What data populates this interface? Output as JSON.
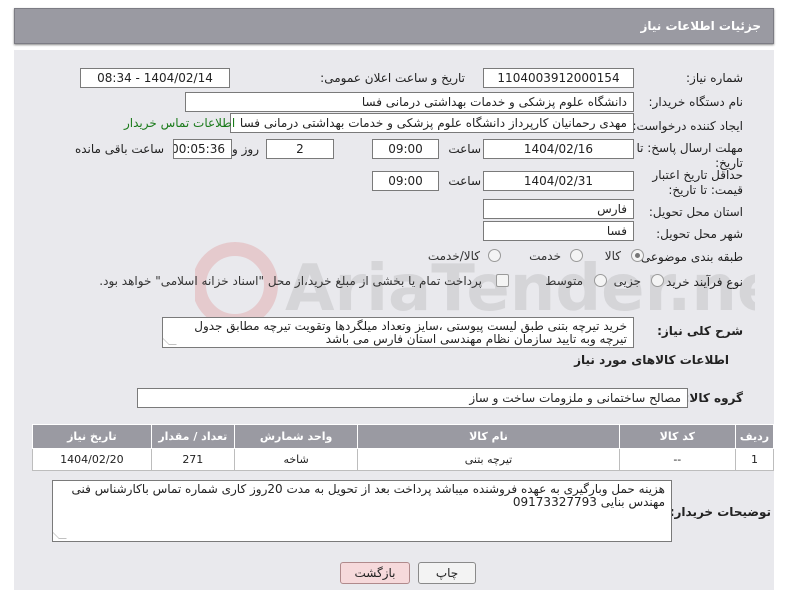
{
  "header": {
    "title": "جزئیات اطلاعات نیاز"
  },
  "fields": {
    "need_number_label": "شماره نیاز:",
    "need_number": "1104003912000154",
    "announce_label": "تاریخ و ساعت اعلان عمومی:",
    "announce_value": "1404/02/14 - 08:34",
    "buyer_org_label": "نام دستگاه خریدار:",
    "buyer_org": "دانشگاه علوم پزشکی و خدمات بهداشتی درمانی فسا",
    "creator_label": "ایجاد کننده درخواست:",
    "creator": "مهدی رحمانیان کارپرداز دانشگاه علوم پزشکی و خدمات بهداشتی درمانی فسا",
    "contact_link": "اطلاعات تماس خریدار",
    "deadline_label": "مهلت ارسال پاسخ: تا تاریخ:",
    "deadline_date": "1404/02/16",
    "time_label": "ساعت",
    "deadline_time": "09:00",
    "days_value": "2",
    "days_label": "روز و",
    "remaining_time": "00:05:36",
    "remaining_label": "ساعت باقی مانده",
    "validity_label": "حداقل تاریخ اعتبار قیمت: تا تاریخ:",
    "validity_date": "1404/02/31",
    "validity_time": "09:00",
    "province_label": "استان محل تحویل:",
    "province": "فارس",
    "city_label": "شهر محل تحویل:",
    "city": "فسا",
    "category_label": "طبقه بندی موضوعی:",
    "category_options": [
      "کالا",
      "خدمت",
      "کالا/خدمت"
    ],
    "process_label": "نوع فرآیند خرید :",
    "process_options": [
      "جزیی",
      "متوسط"
    ],
    "payment_note": "پرداخت تمام یا بخشی از مبلغ خرید،از محل \"اسناد خزانه اسلامی\" خواهد بود."
  },
  "description": {
    "label": "شرح کلی نیاز:",
    "text": "خرید تیرچه بتنی طبق لیست پیوستی ،سایز وتعداد میلگردها وتقویت تیرچه مطابق جدول تیرچه وبه تایید سازمان نظام مهندسی استان فارس می باشد"
  },
  "goods_section": {
    "title": "اطلاعات کالاهای مورد نیاز",
    "group_label": "گروه کالا:",
    "group_value": "مصالح ساختمانی و ملزومات ساخت و ساز"
  },
  "table": {
    "headers": [
      "ردیف",
      "کد کالا",
      "نام کالا",
      "واحد شمارش",
      "تعداد / مقدار",
      "تاریخ نیاز"
    ],
    "rows": [
      [
        "1",
        "--",
        "تیرچه بتنی",
        "شاخه",
        "271",
        "1404/02/20"
      ]
    ]
  },
  "buyer_notes": {
    "label": "توضیحات خریدار:",
    "text": "هزینه حمل وبارگیری به عهده فروشنده میباشد پرداخت بعد از تحویل به مدت 20روز کاری شماره تماس باکارشناس فنی مهندس بنایی 09173327793"
  },
  "buttons": {
    "print": "چاپ",
    "back": "بازگشت"
  },
  "watermark": {
    "brand": "AriaTender.neT"
  }
}
